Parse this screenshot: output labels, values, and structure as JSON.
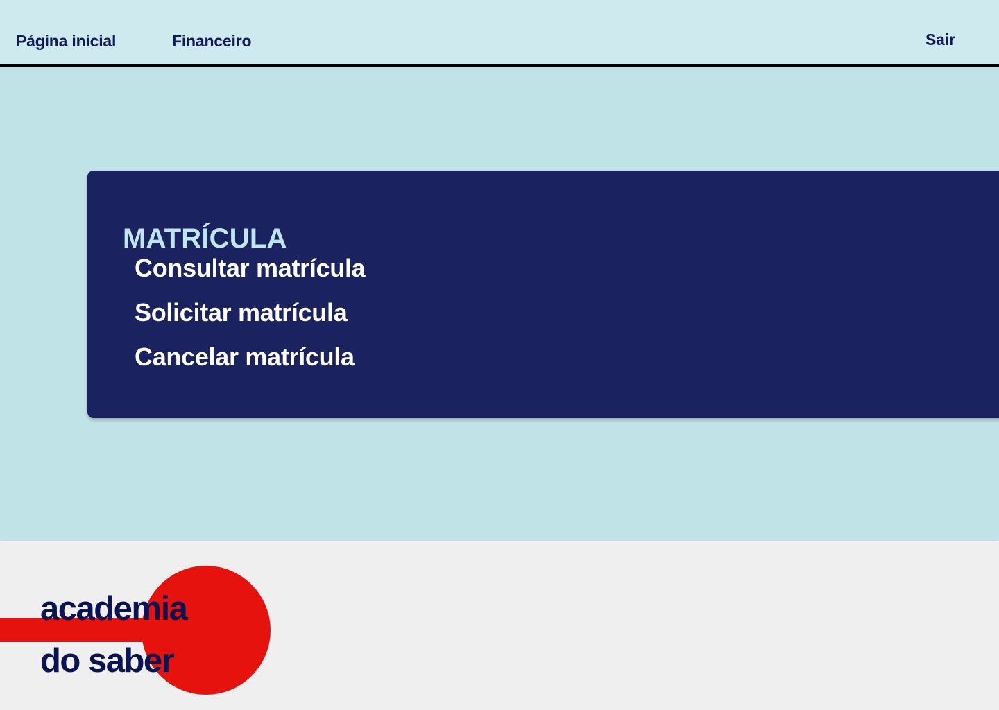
{
  "nav": {
    "home_label": "Página inicial",
    "finance_label": "Financeiro",
    "logout_label": "Sair"
  },
  "card": {
    "title": "MATRÍCULA",
    "items": [
      {
        "label": "Consultar matrícula"
      },
      {
        "label": "Solicitar matrícula"
      },
      {
        "label": "Cancelar matrícula"
      }
    ]
  },
  "logo": {
    "line1": "academia",
    "line2": "do saber"
  },
  "colors": {
    "nav_bg": "#cfeaee",
    "main_bg": "#c0e3e7",
    "card_bg": "#1a235f",
    "card_title": "#bfe6f0",
    "text_dark": "#111a58",
    "accent_red": "#e5120e",
    "footer_bg": "#efefef"
  }
}
